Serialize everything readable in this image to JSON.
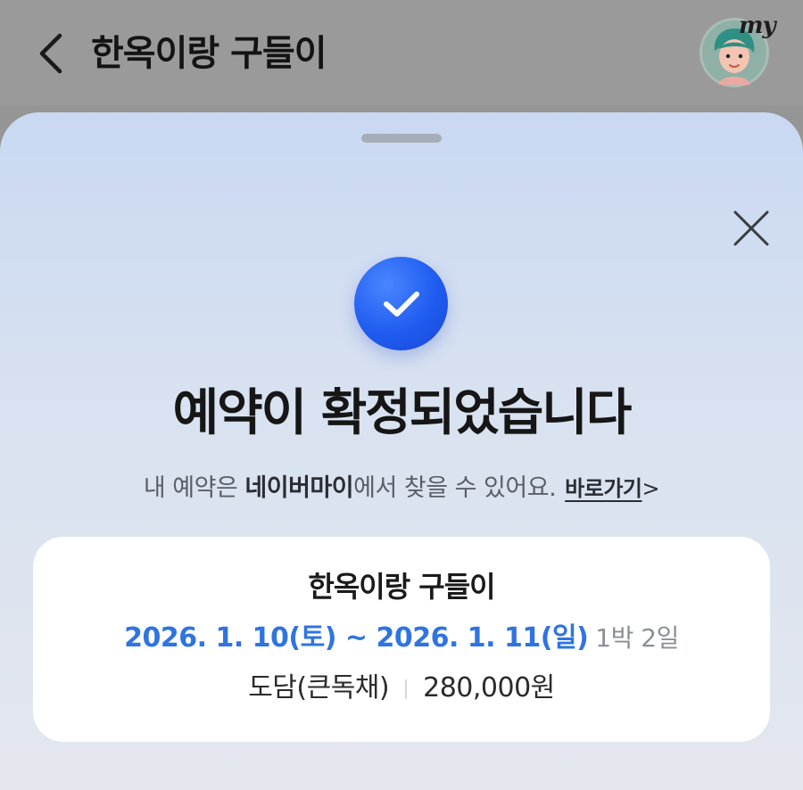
{
  "header": {
    "title": "한옥이랑 구들이",
    "avatar_label": "my"
  },
  "sheet": {
    "headline": "예약이 확정되었습니다",
    "subtext_prefix": "내 예약은 ",
    "subtext_emphasis": "네이버마이",
    "subtext_suffix": "에서 찾을 수 있어요.",
    "link_label": "바로가기",
    "link_chevron": ">"
  },
  "reservation": {
    "name": "한옥이랑 구들이",
    "date_range": "2026. 1. 10(토) ~ 2026. 1. 11(일)",
    "nights": "1박 2일",
    "room": "도담(큰독채)",
    "price": "280,000원"
  },
  "colors": {
    "accent_blue": "#2f74e0",
    "check_blue": "#1f5cf0",
    "overlay_gray": "#959595"
  },
  "icons": {
    "back": "chevron-left-icon",
    "close": "close-icon",
    "confirm": "check-icon"
  }
}
